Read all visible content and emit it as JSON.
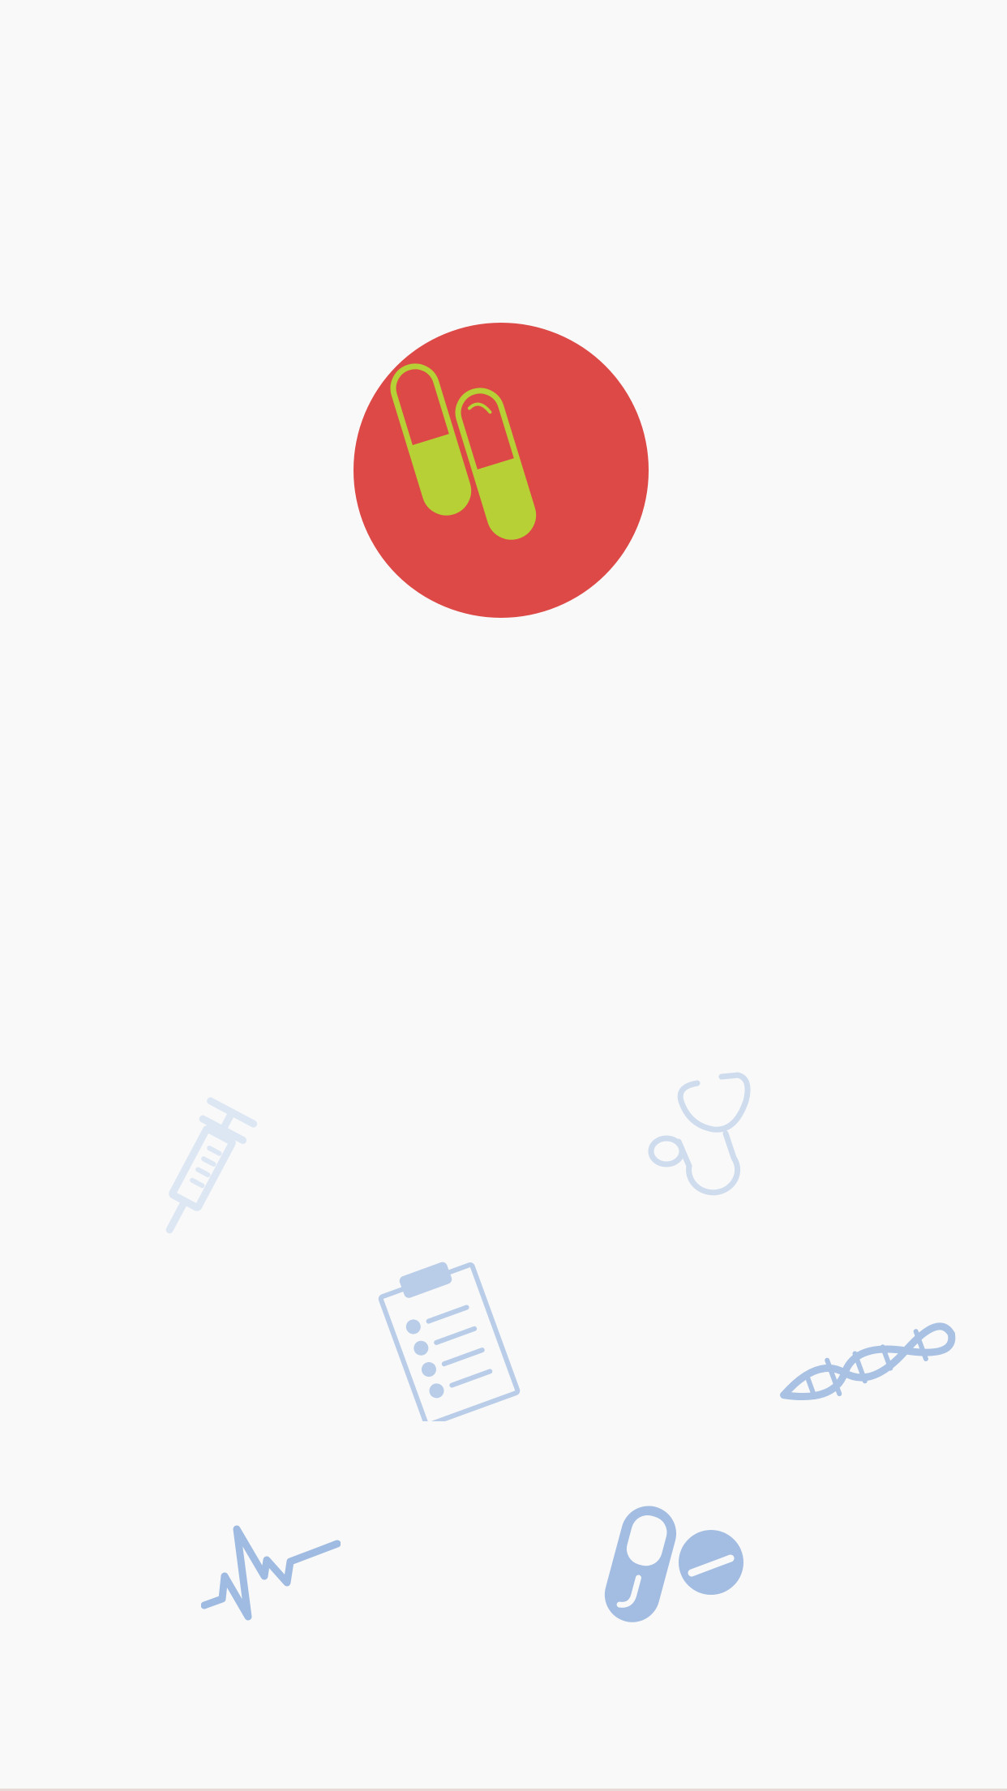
{
  "splash": {
    "logo": {
      "icon": "medicine-capsules-icon",
      "circle_color": "#dd4946",
      "capsule_color": "#b7d035"
    },
    "decorations": [
      {
        "icon": "syringe-icon",
        "color": "#dde7f4"
      },
      {
        "icon": "stethoscope-icon",
        "color": "#cfdcee"
      },
      {
        "icon": "clipboard-icon",
        "color": "#b9cde8"
      },
      {
        "icon": "dna-icon",
        "color": "#a9c2e3"
      },
      {
        "icon": "heartbeat-icon",
        "color": "#9fbbe1"
      },
      {
        "icon": "pills-icon",
        "color": "#a3bde2"
      }
    ]
  }
}
